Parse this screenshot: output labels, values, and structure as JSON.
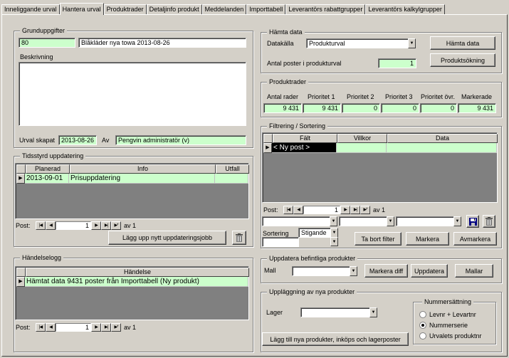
{
  "tabs": [
    "Inneliggande urval",
    "Hantera urval",
    "Produktrader",
    "Detaljinfo produkt",
    "Meddelanden",
    "Importtabell",
    "Leverantörs rabattgrupper",
    "Leverantörs kalkylgrupper"
  ],
  "grund": {
    "title": "Grunduppgifter",
    "id": "80",
    "name": "Blåkläder nya towa 2013-08-26",
    "desc_label": "Beskrivning",
    "created_label": "Urval skapat",
    "created": "2013-08-26",
    "by_label": "Av",
    "by": "Pengvin  administratör (v)"
  },
  "hamta": {
    "title": "Hämta data",
    "source_label": "Datakälla",
    "source": "Produkturval",
    "count_label": "Antal poster i produkturval",
    "count": "1",
    "fetch_button": "Hämta data",
    "search_button": "Produktsökning"
  },
  "produktrader": {
    "title": "Produktrader",
    "headers": [
      "Antal rader",
      "Prioritet 1",
      "Prioritet 2",
      "Prioritet 3",
      "Prioritet övr.",
      "Markerade"
    ],
    "values": [
      "9 431",
      "9 431",
      "0",
      "0",
      "0",
      "9 431"
    ]
  },
  "tidsstyrd": {
    "title": "Tidsstyrd uppdatering",
    "headers": [
      "Planerad",
      "Info",
      "Utfall"
    ],
    "row": [
      "2013-09-01",
      "Prisuppdatering",
      ""
    ],
    "nav_label": "Post:",
    "nav_value": "1",
    "nav_total": "av  1",
    "add_button": "Lägg upp nytt uppdateringsjobb"
  },
  "filter": {
    "title": "Filtrering / Sortering",
    "headers": [
      "Fält",
      "Villkor",
      "Data"
    ],
    "row": "< Ny post >",
    "nav_label": "Post:",
    "nav_value": "1",
    "nav_total": "av  1",
    "sort_label": "Sortering",
    "sort_value": "Stigande",
    "remove_button": "Ta bort filter",
    "mark_button": "Markera",
    "unmark_button": "Avmarkera"
  },
  "logg": {
    "title": "Händelselogg",
    "header": "Händelse",
    "row": "Hämtat data 9431 poster från Importtabell (Ny produkt)",
    "nav_label": "Post:",
    "nav_value": "1",
    "nav_total": "av  1"
  },
  "uppdatera": {
    "title": "Uppdatera befintliga produkter",
    "mall_label": "Mall",
    "diff_button": "Markera diff",
    "update_button": "Uppdatera",
    "templates_button": "Mallar"
  },
  "nya": {
    "title": "Uppläggning av nya produkter",
    "lager_label": "Lager",
    "add_button": "Lägg till nya produkter, inköps och lagerposter",
    "numbering_title": "Nummersättning",
    "options": [
      "Levnr + Levartnr",
      "Nummerserie",
      "Urvalets produktnr"
    ],
    "selected": 1
  }
}
